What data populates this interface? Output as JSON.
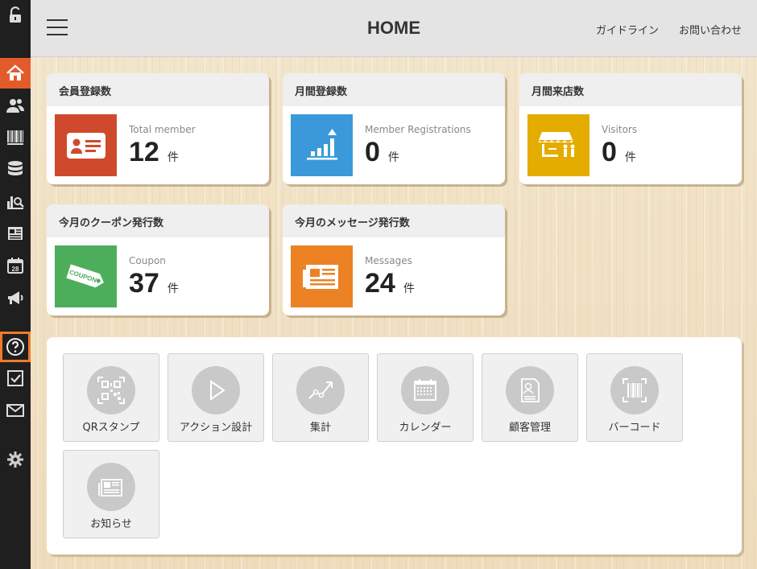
{
  "header": {
    "title": "HOME",
    "links": [
      "ガイドライン",
      "お問い合わせ"
    ]
  },
  "sidebar": {
    "items": [
      {
        "icon": "unlock-icon"
      },
      {
        "icon": "home-icon",
        "active": true
      },
      {
        "icon": "users-icon"
      },
      {
        "icon": "barcode-icon"
      },
      {
        "icon": "database-icon"
      },
      {
        "icon": "chart-search-icon"
      },
      {
        "icon": "newspaper-icon"
      },
      {
        "icon": "calendar-icon",
        "text": "28"
      },
      {
        "icon": "megaphone-icon"
      },
      {
        "icon": "help-icon",
        "highlighted": true
      },
      {
        "icon": "checkbox-icon"
      },
      {
        "icon": "mail-icon"
      },
      {
        "icon": "gear-icon"
      }
    ]
  },
  "stats": [
    {
      "title": "会員登録数",
      "sub": "Total member",
      "value": "12",
      "unit": "件",
      "color": "#cf4a2c",
      "icon": "id-card-icon"
    },
    {
      "title": "月間登録数",
      "sub": "Member Registrations",
      "value": "0",
      "unit": "件",
      "color": "#3a9ad9",
      "icon": "rising-bars-icon"
    },
    {
      "title": "月間来店数",
      "sub": "Visitors",
      "value": "0",
      "unit": "件",
      "color": "#e5ac00",
      "icon": "storefront-icon"
    },
    {
      "title": "今月のクーポン発行数",
      "sub": "Coupon",
      "value": "37",
      "unit": "件",
      "color": "#4cae5b",
      "icon": "coupon-icon",
      "icon_text": "COUPON"
    },
    {
      "title": "今月のメッセージ発行数",
      "sub": "Messages",
      "value": "24",
      "unit": "件",
      "color": "#ec8223",
      "icon": "newspaper-icon"
    }
  ],
  "shortcuts": [
    {
      "label": "QRスタンプ",
      "icon": "qr-code-icon"
    },
    {
      "label": "アクション設計",
      "icon": "play-icon"
    },
    {
      "label": "集計",
      "icon": "trend-icon"
    },
    {
      "label": "カレンダー",
      "icon": "calendar-grid-icon"
    },
    {
      "label": "顧客管理",
      "icon": "customer-profile-icon"
    },
    {
      "label": "バーコード",
      "icon": "barcode-scan-icon"
    },
    {
      "label": "お知らせ",
      "icon": "news-icon"
    }
  ]
}
